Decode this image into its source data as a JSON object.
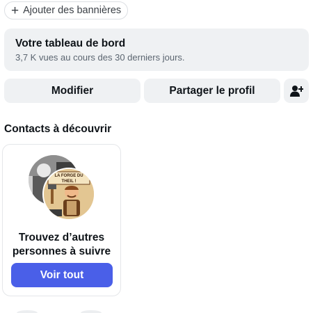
{
  "banner_button": {
    "label": "Ajouter des bannières",
    "icon": "plus-icon"
  },
  "dashboard": {
    "title": "Votre tableau de bord",
    "subtitle": "3,7 K vues au cours des 30 derniers jours."
  },
  "actions": {
    "edit_label": "Modifier",
    "share_label": "Partager le profil",
    "add_icon": "add-person-icon"
  },
  "contacts": {
    "section_title": "Contacts à découvrir",
    "card": {
      "line1": "Trouvez d’autres",
      "line2": "personnes à suivre",
      "button_label": "Voir tout",
      "avatar_text_line1": "LA FORGE DU",
      "avatar_text_line2": "THEIL !"
    }
  },
  "colors": {
    "accent": "#4a5fe8",
    "card_bg": "#eff1f3"
  }
}
